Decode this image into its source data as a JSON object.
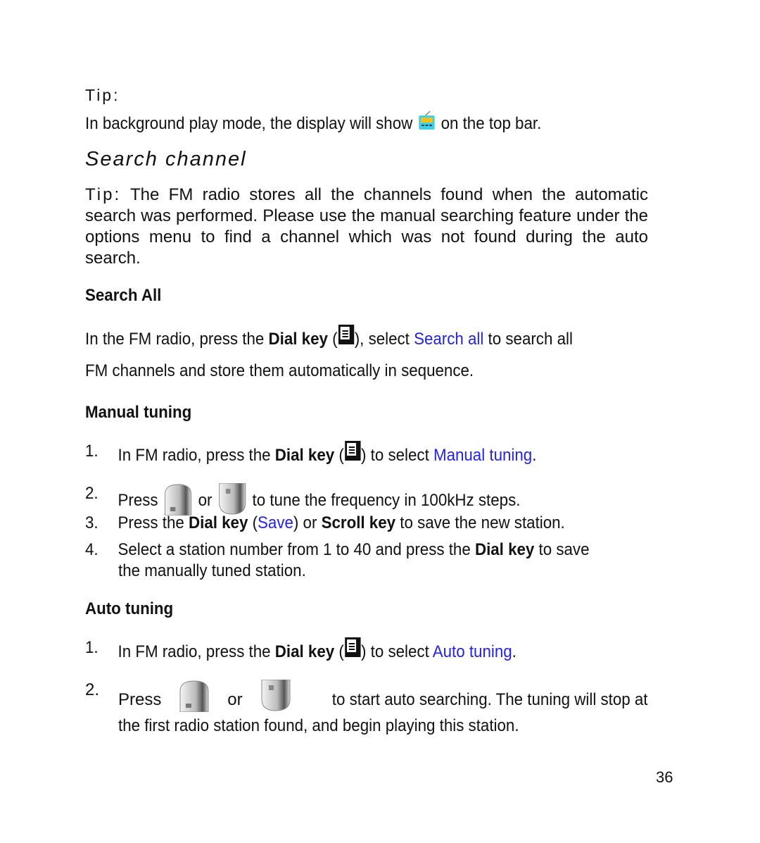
{
  "tip": {
    "label": "Tip:",
    "text_before": "In background play mode, the display will show",
    "icon": "radio-background-icon",
    "text_after": "on the top bar."
  },
  "section": {
    "title": "Search channel",
    "tip_label": "Tip:",
    "tip_text": "The FM radio stores all the channels found when the automatic search was performed. Please use the manual searching feature under the options menu to find a channel which was not found during the auto search."
  },
  "search_all": {
    "heading": "Search All",
    "t1": "In the FM radio, press the",
    "dial_key": "Dial key",
    "paren_open": "(",
    "paren_close": "), select",
    "link": "Search all",
    "t2": "to search all",
    "line2": "FM channels and store them automatically in sequence."
  },
  "manual_tuning": {
    "heading": "Manual tuning",
    "steps": [
      {
        "num": "1.",
        "t1": "In FM radio, press the",
        "bold": "Dial key",
        "p_open": "(",
        "p_close": ") to select",
        "link": "Manual tuning",
        "end": "."
      },
      {
        "num": "2.",
        "t1": "Press",
        "or": "or",
        "t2": "to tune the frequency in 100kHz steps."
      },
      {
        "num": "3.",
        "t1": "Press the",
        "bold1": "Dial key",
        "p_open": "(",
        "link": "Save",
        "p_close": ") or",
        "bold2": "Scroll key",
        "t2": "to save the new station."
      },
      {
        "num": "4.",
        "t1": "Select a station number from 1 to 40 and press the",
        "bold": "Dial key",
        "t2": "to save",
        "line2": "the manually tuned station."
      }
    ]
  },
  "auto_tuning": {
    "heading": "Auto tuning",
    "steps": [
      {
        "num": "1.",
        "t1": "In FM radio, press the",
        "bold": "Dial key",
        "p_open": "(",
        "p_close": ") to select",
        "link": "Auto tuning",
        "end": "."
      },
      {
        "num": "2.",
        "t1": "Press",
        "or": "or",
        "t2": "to start auto searching. The tuning will stop at",
        "line2": "the first radio station found, and begin playing this station."
      }
    ]
  },
  "page_number": "36",
  "colors": {
    "link": "#2323e6",
    "text": "#111111"
  }
}
